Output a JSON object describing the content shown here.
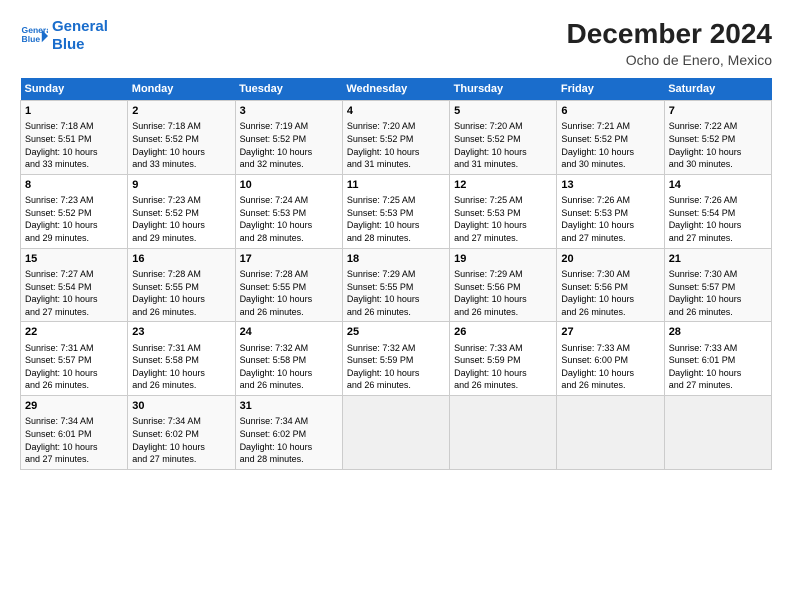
{
  "header": {
    "logo_line1": "General",
    "logo_line2": "Blue",
    "title": "December 2024",
    "subtitle": "Ocho de Enero, Mexico"
  },
  "days_of_week": [
    "Sunday",
    "Monday",
    "Tuesday",
    "Wednesday",
    "Thursday",
    "Friday",
    "Saturday"
  ],
  "weeks": [
    [
      {
        "day": "1",
        "lines": [
          "Sunrise: 7:18 AM",
          "Sunset: 5:51 PM",
          "Daylight: 10 hours",
          "and 33 minutes."
        ]
      },
      {
        "day": "2",
        "lines": [
          "Sunrise: 7:18 AM",
          "Sunset: 5:52 PM",
          "Daylight: 10 hours",
          "and 33 minutes."
        ]
      },
      {
        "day": "3",
        "lines": [
          "Sunrise: 7:19 AM",
          "Sunset: 5:52 PM",
          "Daylight: 10 hours",
          "and 32 minutes."
        ]
      },
      {
        "day": "4",
        "lines": [
          "Sunrise: 7:20 AM",
          "Sunset: 5:52 PM",
          "Daylight: 10 hours",
          "and 31 minutes."
        ]
      },
      {
        "day": "5",
        "lines": [
          "Sunrise: 7:20 AM",
          "Sunset: 5:52 PM",
          "Daylight: 10 hours",
          "and 31 minutes."
        ]
      },
      {
        "day": "6",
        "lines": [
          "Sunrise: 7:21 AM",
          "Sunset: 5:52 PM",
          "Daylight: 10 hours",
          "and 30 minutes."
        ]
      },
      {
        "day": "7",
        "lines": [
          "Sunrise: 7:22 AM",
          "Sunset: 5:52 PM",
          "Daylight: 10 hours",
          "and 30 minutes."
        ]
      }
    ],
    [
      {
        "day": "8",
        "lines": [
          "Sunrise: 7:23 AM",
          "Sunset: 5:52 PM",
          "Daylight: 10 hours",
          "and 29 minutes."
        ]
      },
      {
        "day": "9",
        "lines": [
          "Sunrise: 7:23 AM",
          "Sunset: 5:52 PM",
          "Daylight: 10 hours",
          "and 29 minutes."
        ]
      },
      {
        "day": "10",
        "lines": [
          "Sunrise: 7:24 AM",
          "Sunset: 5:53 PM",
          "Daylight: 10 hours",
          "and 28 minutes."
        ]
      },
      {
        "day": "11",
        "lines": [
          "Sunrise: 7:25 AM",
          "Sunset: 5:53 PM",
          "Daylight: 10 hours",
          "and 28 minutes."
        ]
      },
      {
        "day": "12",
        "lines": [
          "Sunrise: 7:25 AM",
          "Sunset: 5:53 PM",
          "Daylight: 10 hours",
          "and 27 minutes."
        ]
      },
      {
        "day": "13",
        "lines": [
          "Sunrise: 7:26 AM",
          "Sunset: 5:53 PM",
          "Daylight: 10 hours",
          "and 27 minutes."
        ]
      },
      {
        "day": "14",
        "lines": [
          "Sunrise: 7:26 AM",
          "Sunset: 5:54 PM",
          "Daylight: 10 hours",
          "and 27 minutes."
        ]
      }
    ],
    [
      {
        "day": "15",
        "lines": [
          "Sunrise: 7:27 AM",
          "Sunset: 5:54 PM",
          "Daylight: 10 hours",
          "and 27 minutes."
        ]
      },
      {
        "day": "16",
        "lines": [
          "Sunrise: 7:28 AM",
          "Sunset: 5:55 PM",
          "Daylight: 10 hours",
          "and 26 minutes."
        ]
      },
      {
        "day": "17",
        "lines": [
          "Sunrise: 7:28 AM",
          "Sunset: 5:55 PM",
          "Daylight: 10 hours",
          "and 26 minutes."
        ]
      },
      {
        "day": "18",
        "lines": [
          "Sunrise: 7:29 AM",
          "Sunset: 5:55 PM",
          "Daylight: 10 hours",
          "and 26 minutes."
        ]
      },
      {
        "day": "19",
        "lines": [
          "Sunrise: 7:29 AM",
          "Sunset: 5:56 PM",
          "Daylight: 10 hours",
          "and 26 minutes."
        ]
      },
      {
        "day": "20",
        "lines": [
          "Sunrise: 7:30 AM",
          "Sunset: 5:56 PM",
          "Daylight: 10 hours",
          "and 26 minutes."
        ]
      },
      {
        "day": "21",
        "lines": [
          "Sunrise: 7:30 AM",
          "Sunset: 5:57 PM",
          "Daylight: 10 hours",
          "and 26 minutes."
        ]
      }
    ],
    [
      {
        "day": "22",
        "lines": [
          "Sunrise: 7:31 AM",
          "Sunset: 5:57 PM",
          "Daylight: 10 hours",
          "and 26 minutes."
        ]
      },
      {
        "day": "23",
        "lines": [
          "Sunrise: 7:31 AM",
          "Sunset: 5:58 PM",
          "Daylight: 10 hours",
          "and 26 minutes."
        ]
      },
      {
        "day": "24",
        "lines": [
          "Sunrise: 7:32 AM",
          "Sunset: 5:58 PM",
          "Daylight: 10 hours",
          "and 26 minutes."
        ]
      },
      {
        "day": "25",
        "lines": [
          "Sunrise: 7:32 AM",
          "Sunset: 5:59 PM",
          "Daylight: 10 hours",
          "and 26 minutes."
        ]
      },
      {
        "day": "26",
        "lines": [
          "Sunrise: 7:33 AM",
          "Sunset: 5:59 PM",
          "Daylight: 10 hours",
          "and 26 minutes."
        ]
      },
      {
        "day": "27",
        "lines": [
          "Sunrise: 7:33 AM",
          "Sunset: 6:00 PM",
          "Daylight: 10 hours",
          "and 26 minutes."
        ]
      },
      {
        "day": "28",
        "lines": [
          "Sunrise: 7:33 AM",
          "Sunset: 6:01 PM",
          "Daylight: 10 hours",
          "and 27 minutes."
        ]
      }
    ],
    [
      {
        "day": "29",
        "lines": [
          "Sunrise: 7:34 AM",
          "Sunset: 6:01 PM",
          "Daylight: 10 hours",
          "and 27 minutes."
        ]
      },
      {
        "day": "30",
        "lines": [
          "Sunrise: 7:34 AM",
          "Sunset: 6:02 PM",
          "Daylight: 10 hours",
          "and 27 minutes."
        ]
      },
      {
        "day": "31",
        "lines": [
          "Sunrise: 7:34 AM",
          "Sunset: 6:02 PM",
          "Daylight: 10 hours",
          "and 28 minutes."
        ]
      },
      null,
      null,
      null,
      null
    ]
  ]
}
